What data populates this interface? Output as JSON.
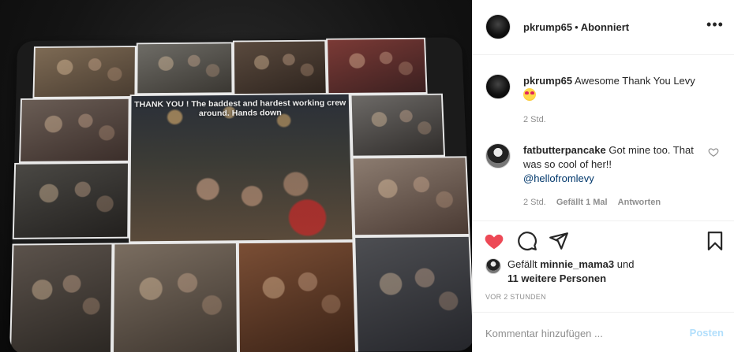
{
  "post": {
    "author": "pkrump65",
    "follow_status": "Abonniert",
    "photo_caption": "THANK YOU ! The baddest and hardest working crew around. Hands down"
  },
  "comments": [
    {
      "username": "pkrump65",
      "text": "Awesome Thank You Levy",
      "emoji": "heart-eyes-emoji",
      "time": "2 Std."
    },
    {
      "username": "fatbutterpancake",
      "text": "Got mine too. That was so cool of her!!",
      "mention": "@hellofromlevy",
      "time": "2 Std.",
      "likes_label": "Gefällt 1 Mal",
      "reply_label": "Antworten"
    }
  ],
  "likes": {
    "prefix": "Gefällt",
    "user": "minnie_mama3",
    "connector": "und",
    "others": "11 weitere Personen"
  },
  "timestamp": "VOR 2 STUNDEN",
  "comment_input": {
    "placeholder": "Kommentar hinzufügen ...",
    "post_label": "Posten"
  },
  "colors": {
    "like_red": "#ed4956",
    "post_disabled": "#b2dffc",
    "mention": "#00376b",
    "meta_gray": "#8e8e8e"
  }
}
